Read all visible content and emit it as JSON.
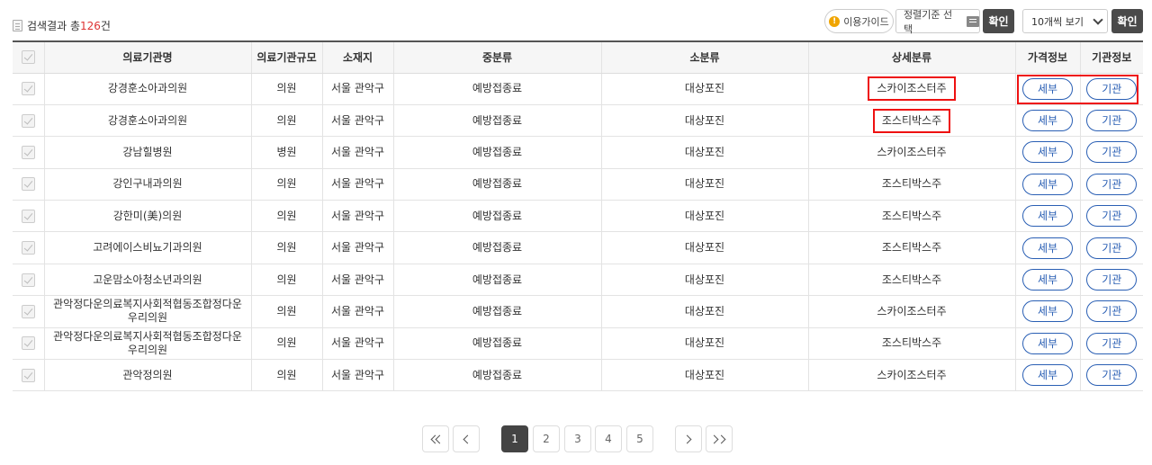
{
  "summary": {
    "label_prefix": "검색결과 총",
    "count": "126",
    "label_suffix": "건"
  },
  "toolbar": {
    "guide_label": "이용가이드",
    "sort_label": "정렬기준 선택",
    "confirm_label": "확인",
    "per_page_value": "10개씩 보기",
    "confirm2_label": "확인"
  },
  "table": {
    "headers": [
      "의료기관명",
      "의료기관규모",
      "소재지",
      "중분류",
      "소분류",
      "상세분류",
      "가격정보",
      "기관정보"
    ],
    "detail_button": "세부",
    "org_button": "기관",
    "rows": [
      {
        "name": "강경훈소아과의원",
        "size": "의원",
        "location": "서울 관악구",
        "mid": "예방접종료",
        "sub": "대상포진",
        "detail": "스카이조스터주"
      },
      {
        "name": "강경훈소아과의원",
        "size": "의원",
        "location": "서울 관악구",
        "mid": "예방접종료",
        "sub": "대상포진",
        "detail": "조스티박스주"
      },
      {
        "name": "강남힐병원",
        "size": "병원",
        "location": "서울 관악구",
        "mid": "예방접종료",
        "sub": "대상포진",
        "detail": "스카이조스터주"
      },
      {
        "name": "강인구내과의원",
        "size": "의원",
        "location": "서울 관악구",
        "mid": "예방접종료",
        "sub": "대상포진",
        "detail": "조스티박스주"
      },
      {
        "name": "강한미(美)의원",
        "size": "의원",
        "location": "서울 관악구",
        "mid": "예방접종료",
        "sub": "대상포진",
        "detail": "조스티박스주"
      },
      {
        "name": "고려에이스비뇨기과의원",
        "size": "의원",
        "location": "서울 관악구",
        "mid": "예방접종료",
        "sub": "대상포진",
        "detail": "조스티박스주"
      },
      {
        "name": "고운맘소아청소년과의원",
        "size": "의원",
        "location": "서울 관악구",
        "mid": "예방접종료",
        "sub": "대상포진",
        "detail": "조스티박스주"
      },
      {
        "name": "관악정다운의료복지사회적협동조합정다운우리의원",
        "size": "의원",
        "location": "서울 관악구",
        "mid": "예방접종료",
        "sub": "대상포진",
        "detail": "스카이조스터주"
      },
      {
        "name": "관악정다운의료복지사회적협동조합정다운우리의원",
        "size": "의원",
        "location": "서울 관악구",
        "mid": "예방접종료",
        "sub": "대상포진",
        "detail": "조스티박스주"
      },
      {
        "name": "관악정의원",
        "size": "의원",
        "location": "서울 관악구",
        "mid": "예방접종료",
        "sub": "대상포진",
        "detail": "스카이조스터주"
      }
    ]
  },
  "pagination": {
    "pages": [
      "1",
      "2",
      "3",
      "4",
      "5"
    ],
    "current": "1"
  },
  "colors": {
    "highlight": "#e11111",
    "accent": "#2a5fb4",
    "count": "#dd3333"
  }
}
